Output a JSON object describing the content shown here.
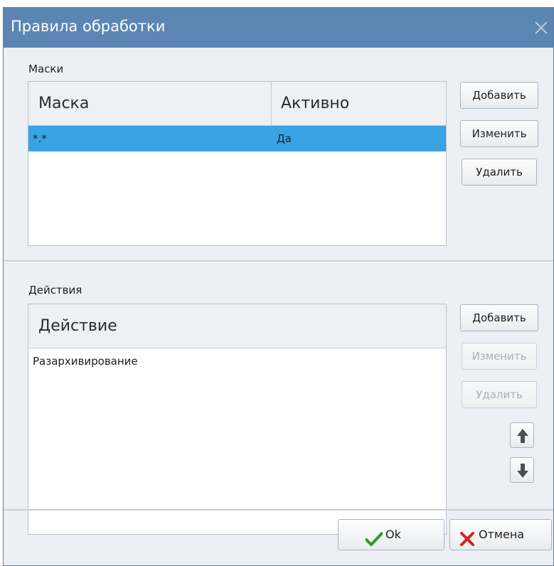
{
  "window": {
    "title": "Правила обработки",
    "close_icon": "close-icon"
  },
  "masks": {
    "label": "Маски",
    "columns": [
      "Маска",
      "Активно"
    ],
    "rows": [
      {
        "mask": "*.*",
        "active": "Да",
        "selected": true
      }
    ],
    "buttons": {
      "add": "Добавить",
      "edit": "Изменить",
      "delete": "Удалить"
    }
  },
  "actions": {
    "label": "Действия",
    "columns": [
      "Действие"
    ],
    "rows": [
      {
        "action": "Разархивирование",
        "selected": false
      }
    ],
    "buttons": {
      "add": "Добавить",
      "edit": "Изменить",
      "delete": "Удалить"
    },
    "disabled": [
      "edit",
      "delete"
    ],
    "move_icons": [
      "arrow-up-icon",
      "arrow-down-icon"
    ]
  },
  "footer": {
    "ok": "Ok",
    "cancel": "Отмена",
    "ok_icon": "checkmark-icon",
    "cancel_icon": "cross-icon"
  },
  "colors": {
    "titlebar": "#5b86b3",
    "selection": "#3aa3e3",
    "ok_check": "#2f9a2f",
    "cancel_cross": "#d2231e"
  }
}
